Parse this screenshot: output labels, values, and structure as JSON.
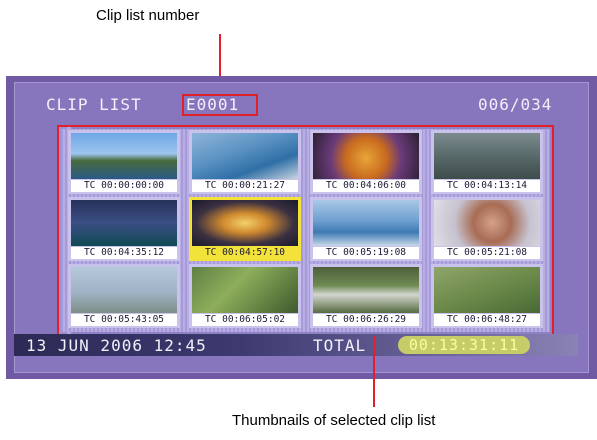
{
  "annotations": {
    "top": "Clip list number",
    "bottom": "Thumbnails of selected clip list"
  },
  "screen": {
    "title": "CLIP LIST",
    "list_number": "E0001",
    "count": "006/034"
  },
  "clips": [
    {
      "tc": "TC 00:00:00:00",
      "scene": "coastal-landscape",
      "selected": false
    },
    {
      "tc": "TC 00:00:21:27",
      "scene": "dolphin-jump",
      "selected": false
    },
    {
      "tc": "TC 00:04:06:00",
      "scene": "sea-creature",
      "selected": false
    },
    {
      "tc": "TC 00:04:13:14",
      "scene": "river-rocks",
      "selected": false
    },
    {
      "tc": "TC 00:04:35:12",
      "scene": "night-harbor",
      "selected": false
    },
    {
      "tc": "TC 00:04:57:10",
      "scene": "carousel",
      "selected": true
    },
    {
      "tc": "TC 00:05:19:08",
      "scene": "poolside",
      "selected": false
    },
    {
      "tc": "TC 00:05:21:08",
      "scene": "portrait",
      "selected": false
    },
    {
      "tc": "TC 00:05:43:05",
      "scene": "beach-birds",
      "selected": false
    },
    {
      "tc": "TC 00:06:05:02",
      "scene": "forest-moss",
      "selected": false
    },
    {
      "tc": "TC 00:06:26:29",
      "scene": "waterfall",
      "selected": false
    },
    {
      "tc": "TC 00:06:48:27",
      "scene": "green-foliage",
      "selected": false
    }
  ],
  "status": {
    "date_time": "13 JUN 2006 12:45",
    "total_label": "TOTAL",
    "total_duration": "00:13:31:11"
  },
  "colors": {
    "callout": "#e0202a",
    "background": "#6f5aa3",
    "selected_frame": "#f2e23a",
    "duration_pill": "#c6cc6a"
  }
}
